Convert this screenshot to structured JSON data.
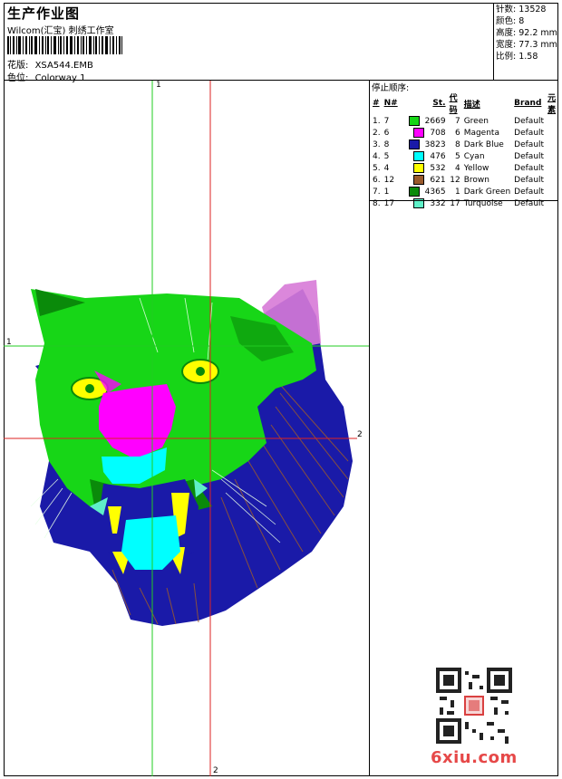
{
  "header": {
    "title": "生产作业图",
    "subtitle": "Wilcom(汇宝) 刺绣工作室",
    "design_label": "花版:",
    "design_value": "XSA544.EMB",
    "colorway_label": "色位:",
    "colorway_value": "Colorway 1"
  },
  "specs": [
    {
      "label": "针数:",
      "value": "13528"
    },
    {
      "label": "颜色:",
      "value": "8"
    },
    {
      "label": "高度:",
      "value": "92.2 mm"
    },
    {
      "label": "宽度:",
      "value": "77.3 mm"
    },
    {
      "label": "比例:",
      "value": "1.58"
    }
  ],
  "stop_sequence": {
    "title": "停止顺序:",
    "columns": [
      "#",
      "N#",
      "St.",
      "代码",
      "描述",
      "Brand",
      "元素"
    ],
    "rows": [
      {
        "idx": "1.",
        "n": "7",
        "st": "2669",
        "code": "7",
        "desc": "Green",
        "brand": "Default",
        "color": "#17d617"
      },
      {
        "idx": "2.",
        "n": "6",
        "st": "708",
        "code": "6",
        "desc": "Magenta",
        "brand": "Default",
        "color": "#ff00ff"
      },
      {
        "idx": "3.",
        "n": "8",
        "st": "3823",
        "code": "8",
        "desc": "Dark Blue",
        "brand": "Default",
        "color": "#1a1aa8"
      },
      {
        "idx": "4.",
        "n": "5",
        "st": "476",
        "code": "5",
        "desc": "Cyan",
        "brand": "Default",
        "color": "#00ffff"
      },
      {
        "idx": "5.",
        "n": "4",
        "st": "532",
        "code": "4",
        "desc": "Yellow",
        "brand": "Default",
        "color": "#ffff00"
      },
      {
        "idx": "6.",
        "n": "12",
        "st": "621",
        "code": "12",
        "desc": "Brown",
        "brand": "Default",
        "color": "#9a5a2c"
      },
      {
        "idx": "7.",
        "n": "1",
        "st": "4365",
        "code": "1",
        "desc": "Dark Green",
        "brand": "Default",
        "color": "#0a8a0a"
      },
      {
        "idx": "8.",
        "n": "17",
        "st": "332",
        "code": "17",
        "desc": "Turquoise",
        "brand": "Default",
        "color": "#5ff0c8"
      }
    ]
  },
  "axes": {
    "v_green_top": "1",
    "h_green_left": "1",
    "h_red_right": "2",
    "v_red_bottom": "2"
  },
  "watermark": "6xiu.com",
  "colors": {
    "guide_green": "#22cc22",
    "guide_red": "#dd2222"
  }
}
